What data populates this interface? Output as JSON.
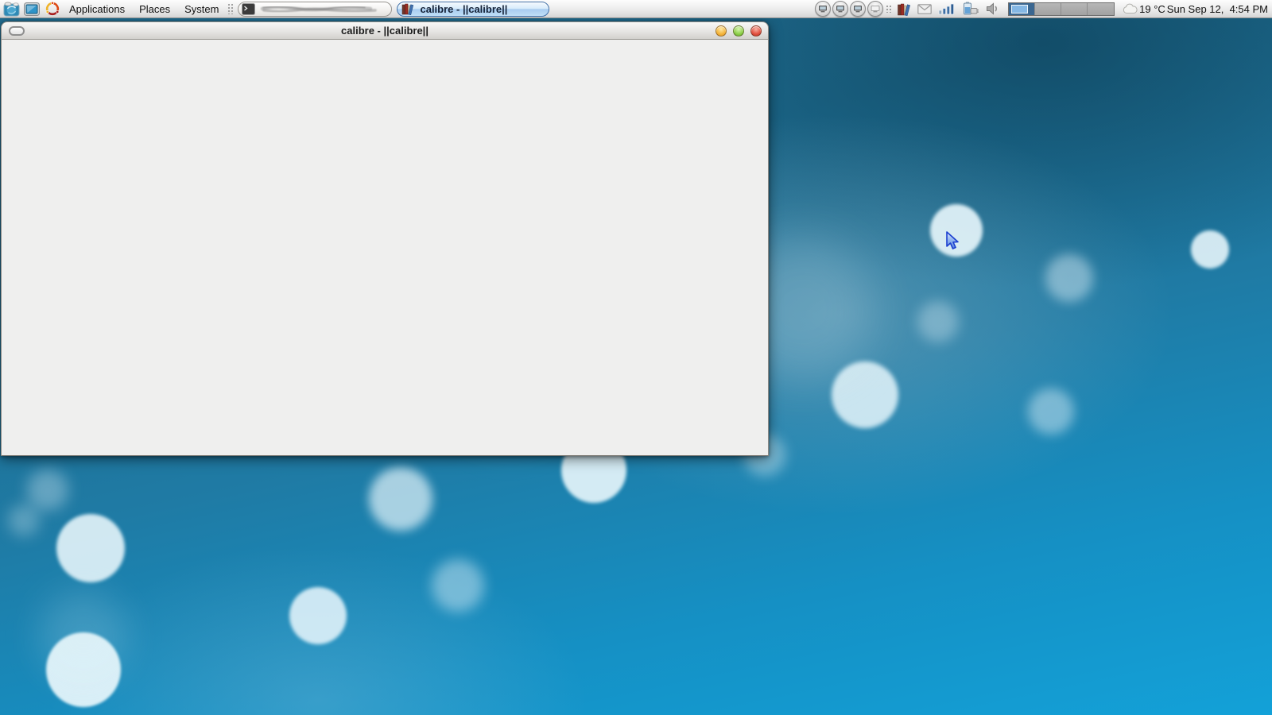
{
  "panel": {
    "launchers": [
      {
        "name": "globe-launcher"
      },
      {
        "name": "display-launcher"
      },
      {
        "name": "ubuntu-logo"
      }
    ],
    "menus": [
      {
        "label": "Applications"
      },
      {
        "label": "Places"
      },
      {
        "label": "System"
      }
    ],
    "taskbar": [
      {
        "label": "",
        "icon": "terminal-icon",
        "active": false,
        "redacted": true
      },
      {
        "label": "calibre - ||calibre||",
        "icon": "calibre-books-icon",
        "active": true
      }
    ],
    "tray_icons": [
      "remote-display-button-1",
      "remote-display-button-2",
      "remote-display-button-3",
      "remote-display-button-4",
      "calibre-books-icon",
      "mail-icon",
      "signal-strength-icon",
      "battery-charging-icon",
      "volume-icon"
    ],
    "workspace_switcher": {
      "count": 4,
      "active_index": 0
    },
    "weather": {
      "temp": "19 °C",
      "icon": "cloud-icon"
    },
    "clock": "Sun Sep 12,  4:54 PM"
  },
  "window": {
    "title": "calibre - ||calibre||",
    "controls": [
      "minimize",
      "maximize",
      "close"
    ]
  },
  "colors": {
    "desktop_top": "#1d6b8e",
    "desktop_bottom": "#13a1d8",
    "active_task_button": "#a9cdf0",
    "titlebar": "#e6e5e3",
    "window_content": "#efefee",
    "minimize_button": "#f5b63c",
    "maximize_button": "#8ed04a",
    "close_button": "#e25140"
  }
}
